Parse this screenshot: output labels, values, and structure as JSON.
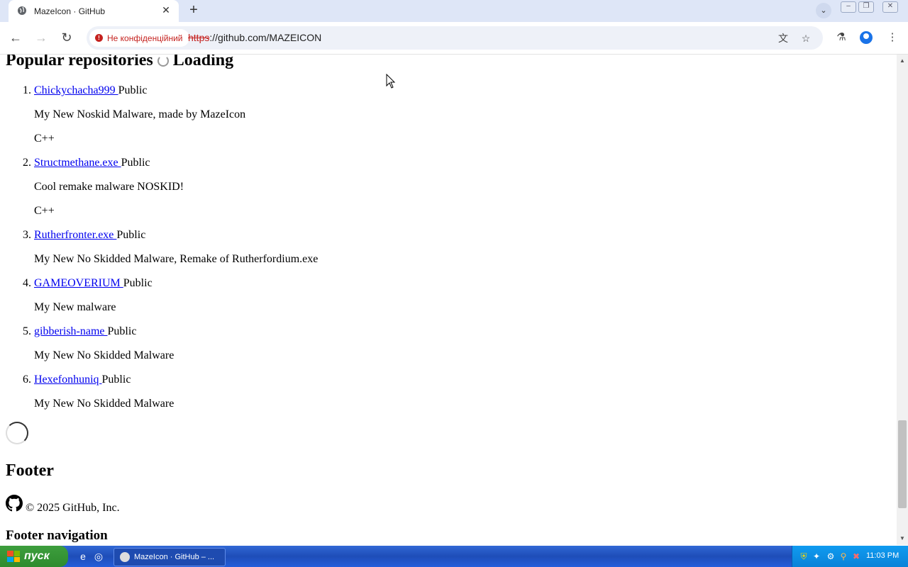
{
  "browser": {
    "tab_title": "MazeIcon · GitHub",
    "security_chip": "Не конфіденційний",
    "url_scheme": "https",
    "url_rest": "://github.com/MAZEICON"
  },
  "page": {
    "heading": "Popular repositories",
    "loading_text": "Loading",
    "repos": [
      {
        "num": "1.",
        "name": "Chickychacha999 ",
        "visibility": "Public",
        "description": "My New Noskid Malware, made by MazeIcon",
        "language": "C++"
      },
      {
        "num": "2.",
        "name": "Structmethane.exe ",
        "visibility": "Public",
        "description": "Cool remake malware NOSKID!",
        "language": "C++"
      },
      {
        "num": "3.",
        "name": "Rutherfronter.exe ",
        "visibility": "Public",
        "description": "My New No Skidded Malware, Remake of Rutherfordium.exe"
      },
      {
        "num": "4.",
        "name": "GAMEOVERIUM ",
        "visibility": "Public",
        "description": "My New malware"
      },
      {
        "num": "5.",
        "name": "gibberish-name ",
        "visibility": "Public",
        "description": "My New No Skidded Malware"
      },
      {
        "num": "6.",
        "name": "Hexefonhuniq ",
        "visibility": "Public",
        "description": "My New No Skidded Malware"
      }
    ],
    "footer_heading": "Footer",
    "copyright": "© 2025 GitHub, Inc.",
    "footer_nav": "Footer navigation"
  },
  "taskbar": {
    "start_label": "пуск",
    "task_label": "MazeIcon · GitHub – ...",
    "clock": "11:03 PM"
  },
  "icons": {
    "back": "arrow-left-icon",
    "forward": "arrow-right-icon",
    "reload": "reload-icon",
    "translate": "translate-icon",
    "bookmark": "star-icon",
    "labs": "flask-icon",
    "profile": "profile-icon",
    "menu": "kebab-menu-icon"
  },
  "colors": {
    "link": "#0000ee",
    "warning": "#c5221f",
    "taskbar": "#245edb",
    "start": "#3d9e3d"
  }
}
